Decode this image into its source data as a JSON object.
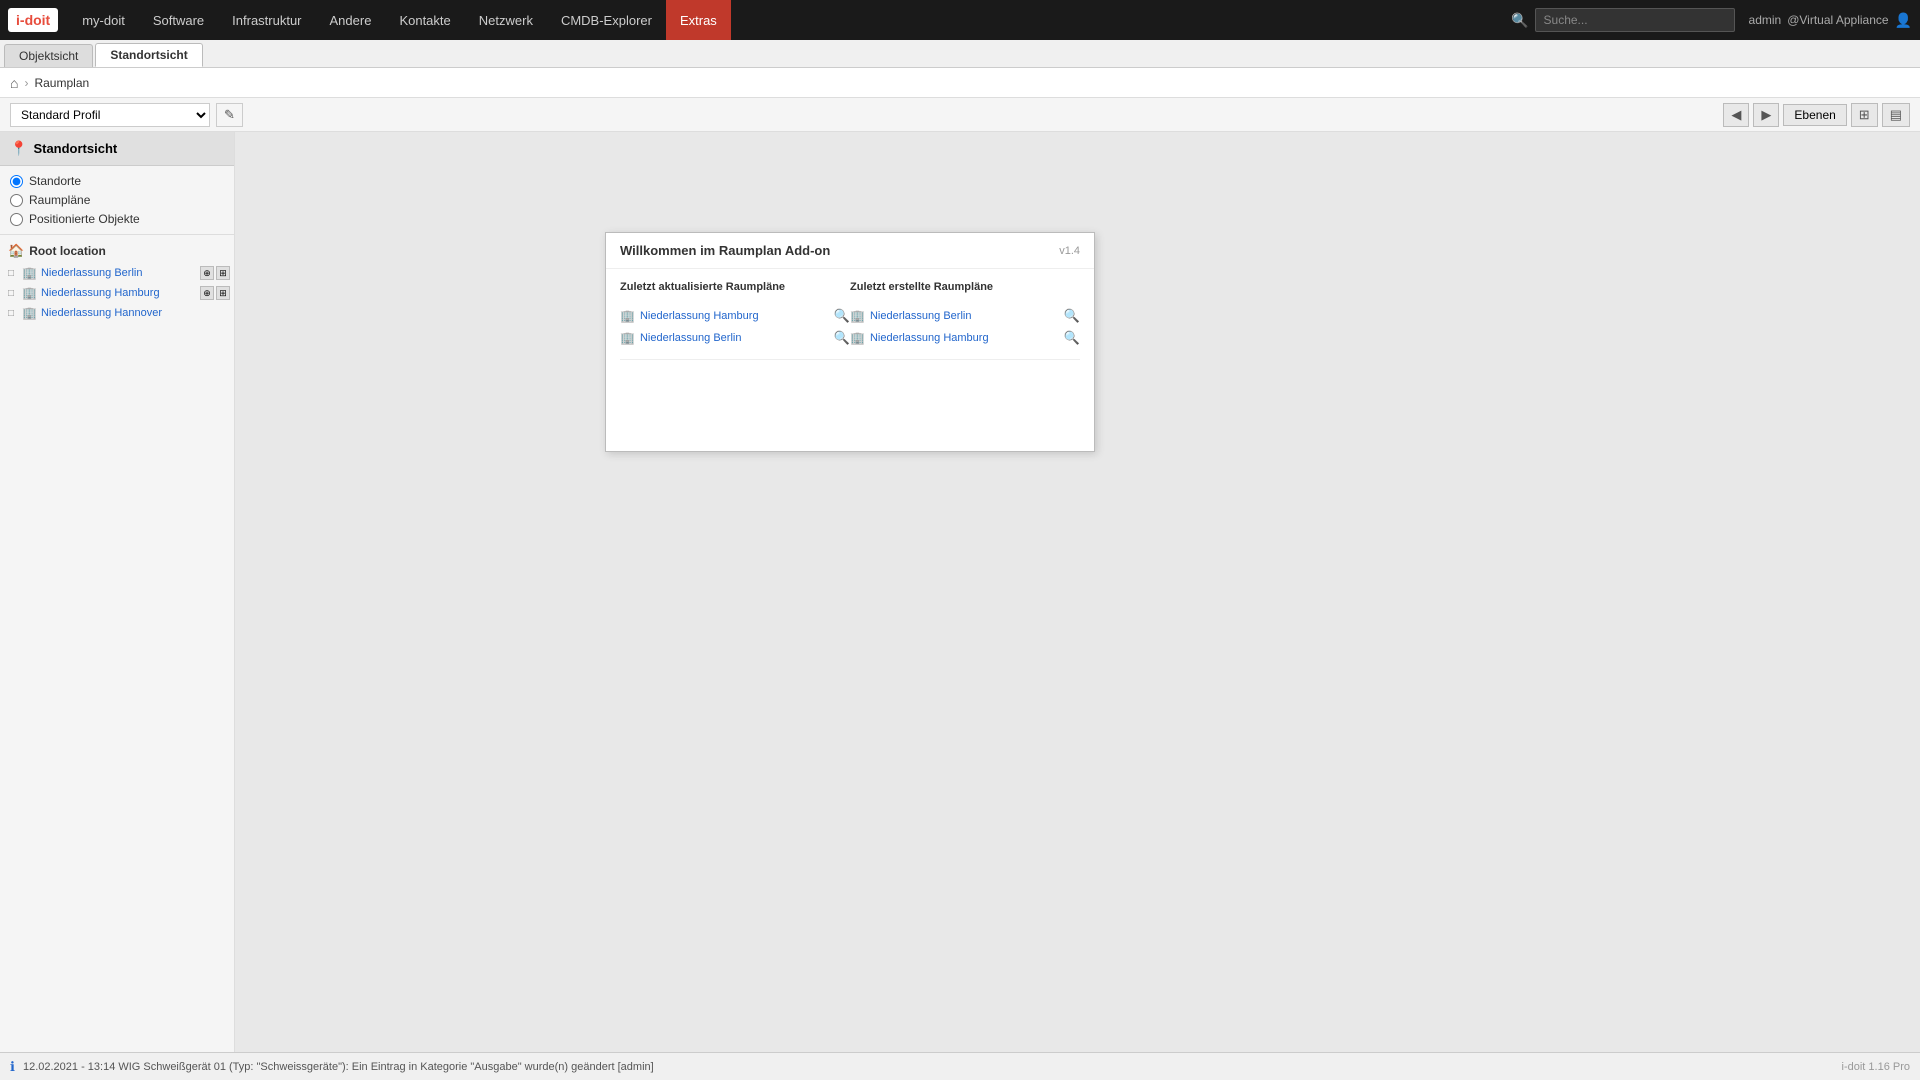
{
  "app": {
    "logo": "i-doit"
  },
  "topnav": {
    "items": [
      {
        "id": "my-doit",
        "label": "my-doit",
        "active": false
      },
      {
        "id": "software",
        "label": "Software",
        "active": false
      },
      {
        "id": "infrastruktur",
        "label": "Infrastruktur",
        "active": false
      },
      {
        "id": "andere",
        "label": "Andere",
        "active": false
      },
      {
        "id": "kontakte",
        "label": "Kontakte",
        "active": false
      },
      {
        "id": "netzwerk",
        "label": "Netzwerk",
        "active": false
      },
      {
        "id": "cmdb-explorer",
        "label": "CMDB-Explorer",
        "active": false
      },
      {
        "id": "extras",
        "label": "Extras",
        "active": true
      }
    ],
    "search_placeholder": "Suche...",
    "user": "admin",
    "appliance": "@Virtual Appliance"
  },
  "tabs": [
    {
      "id": "objektsicht",
      "label": "Objektsicht",
      "active": false
    },
    {
      "id": "standortsicht",
      "label": "Standortsicht",
      "active": true
    }
  ],
  "breadcrumb": {
    "home_icon": "⌂",
    "page": "Raumplan"
  },
  "toolbar": {
    "profile_label": "Standard Profil",
    "edit_icon": "✎",
    "levels_label": "Ebenen",
    "icons": [
      "◀",
      "▶",
      "⊞"
    ]
  },
  "sidebar": {
    "title": "Standortsicht",
    "radio_options": [
      {
        "id": "standorte",
        "label": "Standorte",
        "checked": true
      },
      {
        "id": "raumplane",
        "label": "Raumpläne",
        "checked": false
      },
      {
        "id": "positionierte",
        "label": "Positionierte Objekte",
        "checked": false
      }
    ],
    "root_location": {
      "label": "Root location",
      "children": [
        {
          "label": "Niederlassung Berlin"
        },
        {
          "label": "Niederlassung Hamburg"
        },
        {
          "label": "Niederlassung Hannover"
        }
      ]
    }
  },
  "welcome_dialog": {
    "title": "Willkommen im Raumplan Add-on",
    "version": "v1.4",
    "recent_updated_header": "Zuletzt aktualisierte Raumpläne",
    "recent_created_header": "Zuletzt erstellte Raumpläne",
    "recent_updated": [
      {
        "label": "Niederlassung Hamburg"
      },
      {
        "label": "Niederlassung Berlin"
      }
    ],
    "recent_created": [
      {
        "label": "Niederlassung Berlin"
      },
      {
        "label": "Niederlassung Hamburg"
      }
    ]
  },
  "statusbar": {
    "icon": "ℹ",
    "message": "12.02.2021 - 13:14 WIG Schweißgerät 01 (Typ: \"Schweissgeräte\"): Ein Eintrag in Kategorie \"Ausgabe\" wurde(n) geändert [admin]",
    "version": "i-doit 1.16 Pro"
  }
}
